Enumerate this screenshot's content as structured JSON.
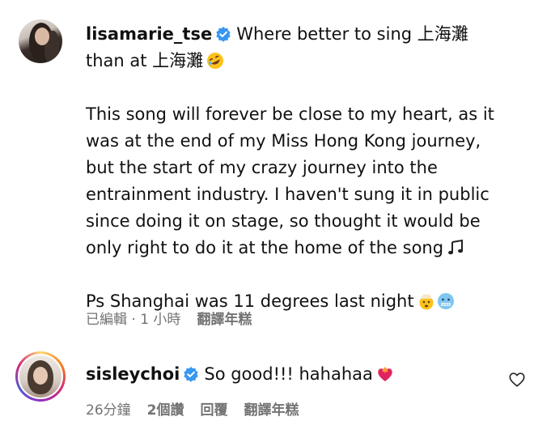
{
  "comment1": {
    "username": "lisamarie_tse",
    "line1": "Where better to sing 上海灘",
    "line2": "than at 上海灘",
    "body_lines": [
      "This song will forever be close to my heart, as it",
      "was at the end of my Miss Hong Kong journey,",
      "but the start of my crazy journey into the",
      "entrainment industry. I haven't sung it in public",
      "since doing it on stage, so thought it would be",
      "only right to do it at the home of the song"
    ],
    "ps_line": "Ps Shanghai was 11 degrees last night",
    "meta_edited": "已編輯 · 1 小時",
    "meta_translate": "翻譯年糕",
    "icons": [
      "verified-badge-icon",
      "rofl-emoji-icon",
      "music-notes-emoji-icon",
      "exploding-head-emoji-icon",
      "cold-face-emoji-icon"
    ]
  },
  "comment2": {
    "username": "sisleychoi",
    "text": "So good!!! hahahaa",
    "meta_time": "26分鐘",
    "meta_likes": "2個讚",
    "meta_reply": "回覆",
    "meta_translate": "翻譯年糕",
    "icons": [
      "verified-badge-icon",
      "heart-on-fire-emoji-icon",
      "like-heart-icon"
    ]
  },
  "colors": {
    "verified": "#3897f0",
    "meta_text": "#737373",
    "text": "#111111"
  }
}
